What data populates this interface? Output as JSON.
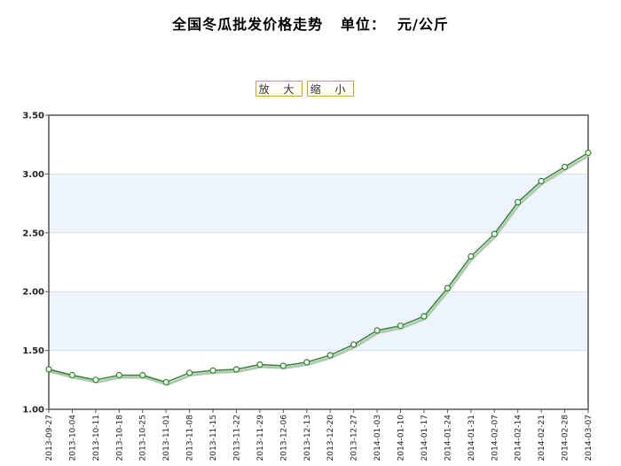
{
  "title": "全国冬瓜批发价格走势   单位：  元/公斤",
  "controls": {
    "zoom_in_label": "放 大",
    "zoom_out_label": "缩 小"
  },
  "colors": {
    "line": "#2a8a2a",
    "shadow": "#b9c4b9",
    "band": "#eef4fb",
    "frame": "#555555",
    "grid": "#d8dde3"
  },
  "chart_data": {
    "type": "line",
    "title": "全国冬瓜批发价格走势   单位：  元/公斤",
    "xlabel": "",
    "ylabel": "",
    "ylim": [
      1.0,
      3.5
    ],
    "yticks": [
      "1.00",
      "1.50",
      "2.00",
      "2.50",
      "3.00",
      "3.50"
    ],
    "grid": true,
    "categories": [
      "2013-09-27",
      "2013-10-04",
      "2013-10-11",
      "2013-10-18",
      "2013-10-25",
      "2013-11-01",
      "2013-11-08",
      "2013-11-15",
      "2013-11-22",
      "2013-11-29",
      "2013-12-06",
      "2013-12-13",
      "2013-12-20",
      "2013-12-27",
      "2014-01-03",
      "2014-01-10",
      "2014-01-17",
      "2014-01-24",
      "2014-01-31",
      "2014-02-07",
      "2014-02-14",
      "2014-02-21",
      "2014-02-28",
      "2014-03-07"
    ],
    "series": [
      {
        "values": [
          1.34,
          1.29,
          1.25,
          1.29,
          1.29,
          1.23,
          1.31,
          1.33,
          1.34,
          1.38,
          1.37,
          1.4,
          1.46,
          1.55,
          1.67,
          1.71,
          1.79,
          2.03,
          2.3,
          2.49,
          2.76,
          2.94,
          3.06,
          3.18
        ]
      }
    ]
  }
}
